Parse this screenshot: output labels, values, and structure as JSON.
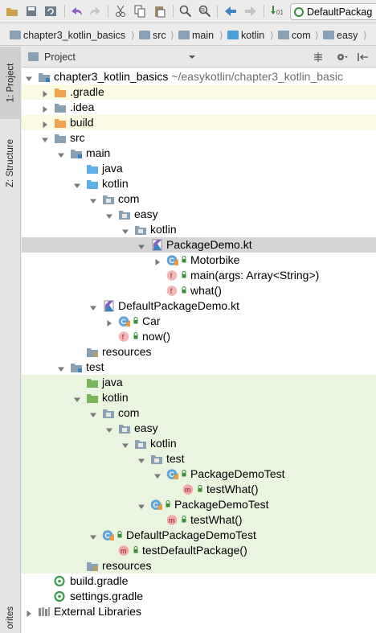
{
  "toolbar": {
    "icons": [
      "open-icon",
      "save-icon",
      "sync-icon",
      "undo-icon",
      "redo-icon",
      "cut-icon",
      "copy-icon",
      "paste-icon",
      "find-icon",
      "replace-icon",
      "back-icon",
      "forward-icon",
      "make-icon"
    ],
    "run_config": "DefaultPackag"
  },
  "breadcrumb": [
    "chapter3_kotlin_basics",
    "src",
    "main",
    "kotlin",
    "com",
    "easy"
  ],
  "left_stripe": {
    "project_tab": "1: Project",
    "structure_tab": "Z: Structure",
    "favorites_tab": "orites"
  },
  "panel": {
    "title": "Project",
    "icons": [
      "collapse-all-icon",
      "settings-icon",
      "hide-icon"
    ]
  },
  "tree": [
    {
      "label": "chapter3_kotlin_basics",
      "suffix": " ~/easykotlin/chapter3_kotlin_basic",
      "icon": "module",
      "depth": 0,
      "arrow": "down",
      "bg": "none"
    },
    {
      "label": ".gradle",
      "icon": "folder-orange",
      "depth": 1,
      "arrow": "right",
      "bg": "yellow"
    },
    {
      "label": ".idea",
      "icon": "folder-gray",
      "depth": 1,
      "arrow": "right",
      "bg": "none"
    },
    {
      "label": "build",
      "icon": "folder-orange",
      "depth": 1,
      "arrow": "right",
      "bg": "yellow"
    },
    {
      "label": "src",
      "icon": "folder-gray",
      "depth": 1,
      "arrow": "down",
      "bg": "none"
    },
    {
      "label": "main",
      "icon": "folder-module",
      "depth": 2,
      "arrow": "down",
      "bg": "none"
    },
    {
      "label": "java",
      "icon": "folder-blue",
      "depth": 3,
      "arrow": "none",
      "bg": "none"
    },
    {
      "label": "kotlin",
      "icon": "folder-blue",
      "depth": 3,
      "arrow": "down",
      "bg": "none"
    },
    {
      "label": "com",
      "icon": "package",
      "depth": 4,
      "arrow": "down",
      "bg": "none"
    },
    {
      "label": "easy",
      "icon": "package",
      "depth": 5,
      "arrow": "down",
      "bg": "none"
    },
    {
      "label": "kotlin",
      "icon": "package",
      "depth": 6,
      "arrow": "down",
      "bg": "none"
    },
    {
      "label": "PackageDemo.kt",
      "icon": "kotlin-file",
      "depth": 7,
      "arrow": "down",
      "bg": "selected"
    },
    {
      "label": "Motorbike",
      "icon": "class",
      "depth": 8,
      "arrow": "right",
      "bg": "none"
    },
    {
      "label": "main(args: Array<String>)",
      "icon": "function",
      "depth": 8,
      "arrow": "none",
      "bg": "none"
    },
    {
      "label": "what()",
      "icon": "function",
      "depth": 8,
      "arrow": "none",
      "bg": "none"
    },
    {
      "label": "DefaultPackageDemo.kt",
      "icon": "kotlin-file",
      "depth": 4,
      "arrow": "down",
      "bg": "none"
    },
    {
      "label": "Car",
      "icon": "class",
      "depth": 5,
      "arrow": "right",
      "bg": "none"
    },
    {
      "label": "now()",
      "icon": "function",
      "depth": 5,
      "arrow": "none",
      "bg": "none"
    },
    {
      "label": "resources",
      "icon": "folder-res",
      "depth": 3,
      "arrow": "none",
      "bg": "none"
    },
    {
      "label": "test",
      "icon": "folder-module",
      "depth": 2,
      "arrow": "down",
      "bg": "none"
    },
    {
      "label": "java",
      "icon": "folder-green",
      "depth": 3,
      "arrow": "none",
      "bg": "green"
    },
    {
      "label": "kotlin",
      "icon": "folder-green",
      "depth": 3,
      "arrow": "down",
      "bg": "green"
    },
    {
      "label": "com",
      "icon": "package",
      "depth": 4,
      "arrow": "down",
      "bg": "green"
    },
    {
      "label": "easy",
      "icon": "package",
      "depth": 5,
      "arrow": "down",
      "bg": "green"
    },
    {
      "label": "kotlin",
      "icon": "package",
      "depth": 6,
      "arrow": "down",
      "bg": "green"
    },
    {
      "label": "test",
      "icon": "package",
      "depth": 7,
      "arrow": "down",
      "bg": "green"
    },
    {
      "label": "PackageDemoTest",
      "icon": "class",
      "depth": 8,
      "arrow": "down",
      "bg": "green"
    },
    {
      "label": "testWhat()",
      "icon": "method",
      "depth": 9,
      "arrow": "none",
      "bg": "green"
    },
    {
      "label": "PackageDemoTest",
      "icon": "class",
      "depth": 7,
      "arrow": "down",
      "bg": "green"
    },
    {
      "label": "testWhat()",
      "icon": "method",
      "depth": 8,
      "arrow": "none",
      "bg": "green"
    },
    {
      "label": "DefaultPackageDemoTest",
      "icon": "class",
      "depth": 4,
      "arrow": "down",
      "bg": "green"
    },
    {
      "label": "testDefaultPackage()",
      "icon": "method",
      "depth": 5,
      "arrow": "none",
      "bg": "green"
    },
    {
      "label": "resources",
      "icon": "folder-res",
      "depth": 3,
      "arrow": "none",
      "bg": "green"
    },
    {
      "label": "build.gradle",
      "icon": "gradle",
      "depth": 1,
      "arrow": "none",
      "bg": "none"
    },
    {
      "label": "settings.gradle",
      "icon": "gradle",
      "depth": 1,
      "arrow": "none",
      "bg": "none"
    },
    {
      "label": "External Libraries",
      "icon": "libraries",
      "depth": 0,
      "arrow": "right",
      "bg": "none"
    }
  ]
}
